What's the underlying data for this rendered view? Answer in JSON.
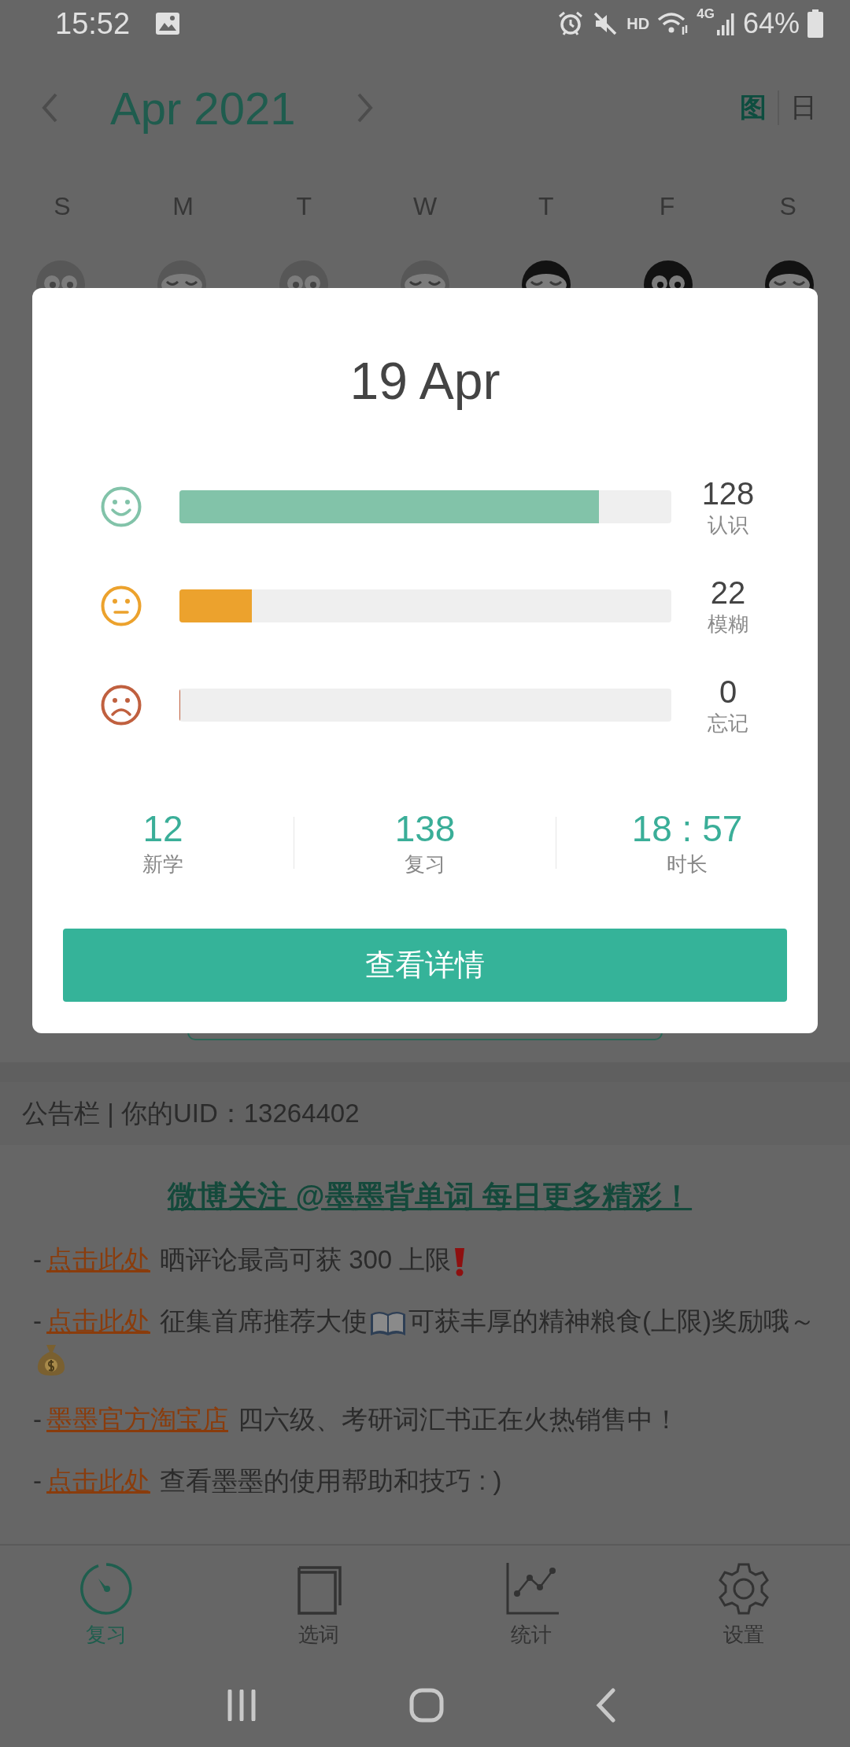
{
  "status_bar": {
    "time": "15:52",
    "hd": "HD",
    "network": "4G",
    "battery": "64%"
  },
  "header": {
    "month": "Apr 2021",
    "view_tabs": [
      {
        "label": "图",
        "selected": true
      },
      {
        "label": "日",
        "selected": false
      }
    ]
  },
  "weekdays": [
    "S",
    "M",
    "T",
    "W",
    "T",
    "F",
    "S"
  ],
  "mascots": [
    {
      "kind": "awake",
      "dark": false
    },
    {
      "kind": "asleep",
      "dark": false
    },
    {
      "kind": "awake",
      "dark": false
    },
    {
      "kind": "asleep",
      "dark": false
    },
    {
      "kind": "asleep",
      "dark": true
    },
    {
      "kind": "awake",
      "dark": true
    },
    {
      "kind": "asleep",
      "dark": true
    }
  ],
  "dialog": {
    "title": "19 Apr",
    "rows": [
      {
        "kind": "happy",
        "color": "#82c3a9",
        "level": 0.853,
        "count": "128",
        "label": "认识"
      },
      {
        "kind": "neutral",
        "color": "#eca22d",
        "level": 0.147,
        "count": "22",
        "label": "模糊"
      },
      {
        "kind": "sad",
        "color": "#c0603f",
        "level": 0,
        "count": "0",
        "label": "忘记"
      }
    ],
    "stats": [
      {
        "value": "12",
        "label": "新学"
      },
      {
        "value": "138",
        "label": "复习"
      },
      {
        "value": "18 : 57",
        "label": "时长"
      }
    ],
    "button": "查看详情"
  },
  "bulletin": {
    "header": "公告栏 | 你的UID：13264402",
    "weibo_link": "微博关注 @墨墨背单词 每日更多精彩！",
    "items": [
      {
        "bullet": "-",
        "link": "点击此处",
        "parts": [
          "晒评论最高可获 300 上限"
        ]
      },
      {
        "bullet": "-",
        "link": "点击此处",
        "parts": [
          "征集首席推荐大使",
          "可获丰厚的精神粮食(上限)奖励哦～"
        ]
      },
      {
        "bullet": "-",
        "link": "墨墨官方淘宝店",
        "parts": [
          "四六级、考研词汇书正在火热销售中！"
        ]
      },
      {
        "bullet": "-",
        "link": "点击此处",
        "parts": [
          "查看墨墨的使用帮助和技巧 : )"
        ]
      }
    ]
  },
  "bottom_nav": [
    {
      "label": "复习",
      "selected": true
    },
    {
      "label": "选词",
      "selected": false
    },
    {
      "label": "统计",
      "selected": false
    },
    {
      "label": "设置",
      "selected": false
    }
  ]
}
